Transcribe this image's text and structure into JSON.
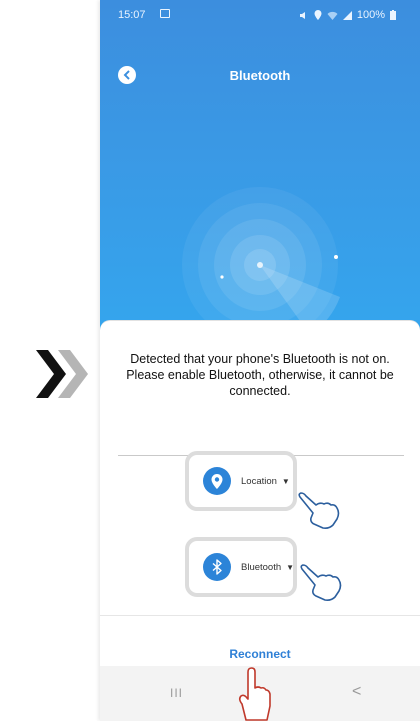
{
  "status_bar": {
    "time": "15:07",
    "battery": "100%"
  },
  "header": {
    "title": "Bluetooth"
  },
  "message": "Detected that your phone's Bluetooth is not on. Please enable Bluetooth, otherwise, it cannot be connected.",
  "permissions": [
    {
      "label": "Location",
      "icon": "location-pin-icon"
    },
    {
      "label": "Bluetooth",
      "icon": "bluetooth-icon"
    }
  ],
  "reconnect_label": "Reconnect",
  "nav_bar": {
    "recents": "III",
    "back": "<"
  },
  "colors": {
    "accent": "#2c84d8",
    "header_gradient_top": "#3c8ede",
    "header_gradient_bottom": "#34a6ee",
    "reconnect": "#2f80d6"
  }
}
